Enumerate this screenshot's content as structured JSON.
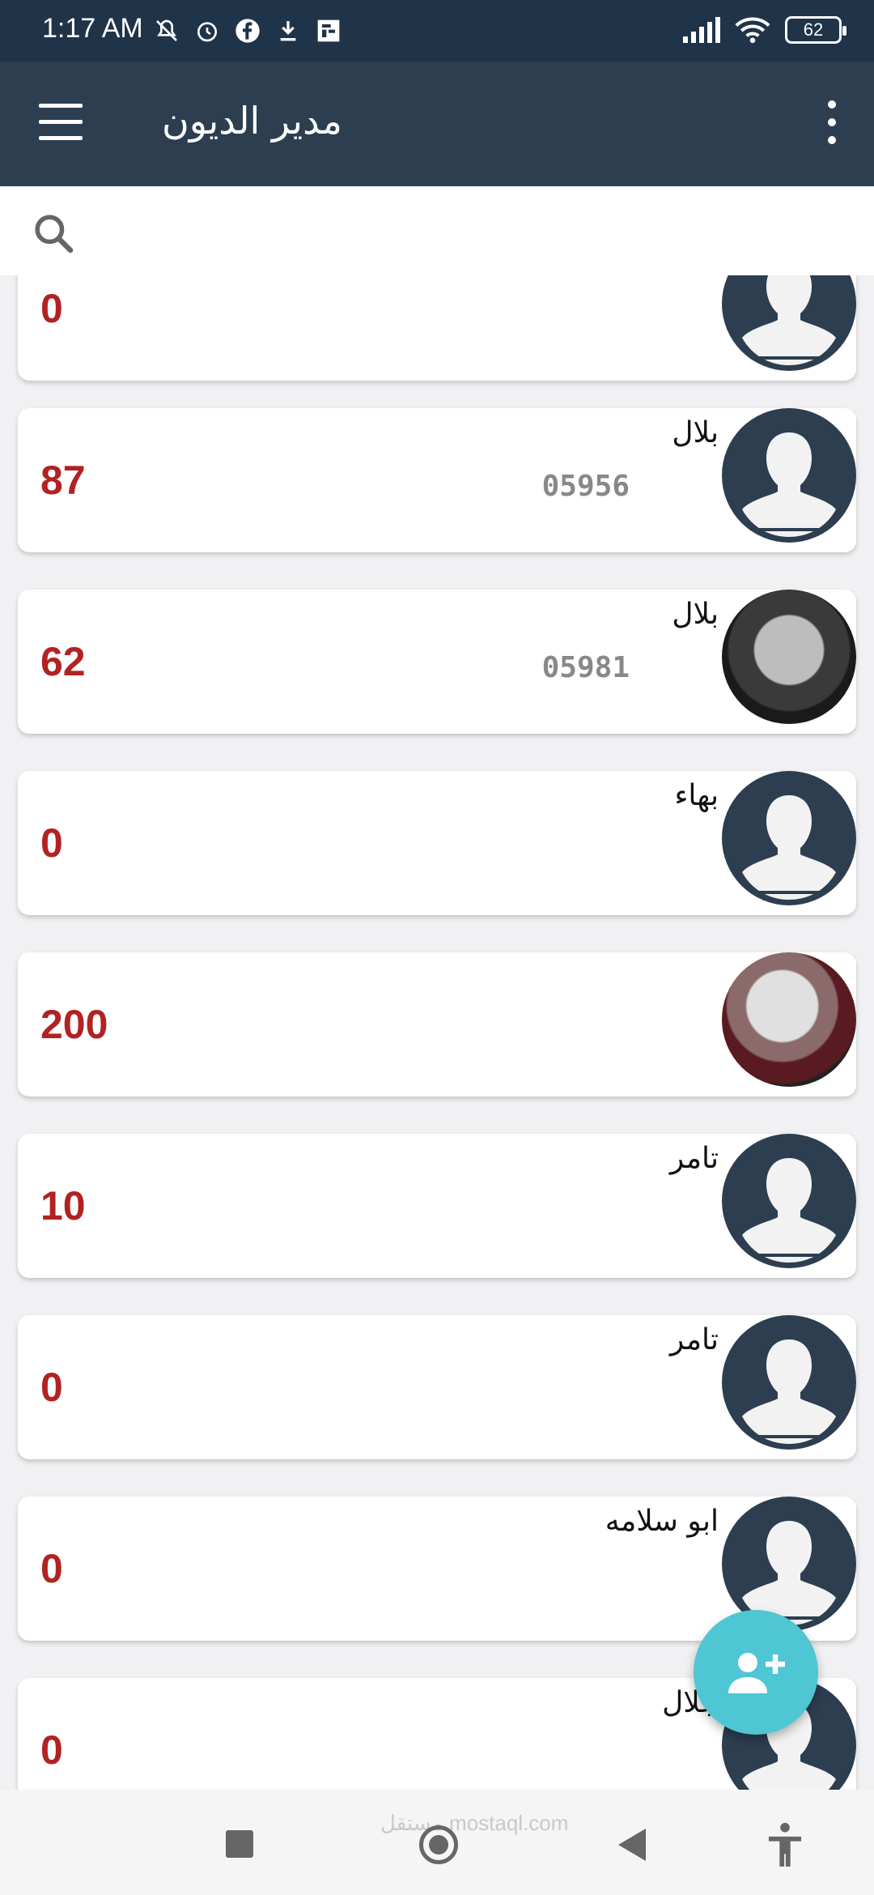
{
  "status_bar": {
    "time": "1:17 AM",
    "battery": "62",
    "icons": [
      "mute-icon",
      "alarm-icon",
      "facebook-icon",
      "download-icon",
      "app-icon",
      "signal-icon",
      "wifi-icon",
      "battery-icon"
    ]
  },
  "app_bar": {
    "title": "مدير الديون",
    "menu_icon": "menu-icon",
    "overflow_icon": "more-vert-icon"
  },
  "search": {
    "placeholder": "",
    "icon": "search-icon"
  },
  "contacts": [
    {
      "name": "",
      "phone": "",
      "amount": "0",
      "avatar": "default"
    },
    {
      "name": "بلال",
      "phone": "05956",
      "amount": "87",
      "avatar": "default"
    },
    {
      "name": "بلال",
      "phone": "05981",
      "amount": "62",
      "avatar": "photo"
    },
    {
      "name": "بهاء",
      "phone": "",
      "amount": "0",
      "avatar": "default"
    },
    {
      "name": "",
      "phone": "",
      "amount": "200",
      "avatar": "photo"
    },
    {
      "name": "تامر",
      "phone": "",
      "amount": "10",
      "avatar": "default"
    },
    {
      "name": "تامر",
      "phone": "",
      "amount": "0",
      "avatar": "default"
    },
    {
      "name": "ابو سلامه",
      "phone": "",
      "amount": "0",
      "avatar": "default"
    },
    {
      "name": "جلال",
      "phone": "",
      "amount": "0",
      "avatar": "default"
    }
  ],
  "fab": {
    "icon": "add-person-icon"
  },
  "colors": {
    "status_bar": "#1f3349",
    "app_bar": "#2d3e50",
    "amount": "#b22222",
    "fab": "#4ec6d3",
    "avatar": "#2d3e50"
  },
  "nav_bar": {
    "icons": [
      "recents-icon",
      "home-icon",
      "back-icon",
      "accessibility-icon"
    ],
    "watermark": "مستقل mostaql.com"
  }
}
